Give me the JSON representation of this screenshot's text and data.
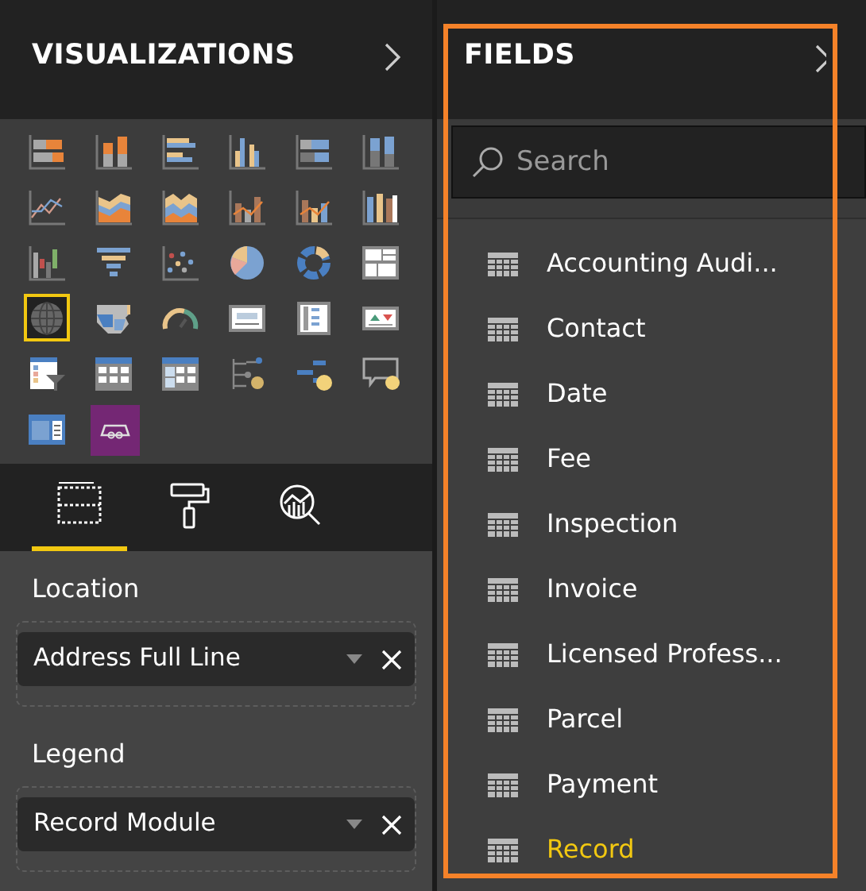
{
  "visualizations": {
    "title": "VISUALIZATIONS",
    "visuals": [
      {
        "selected": false
      },
      {
        "selected": false
      },
      {
        "selected": false
      },
      {
        "selected": false
      },
      {
        "selected": false
      },
      {
        "selected": false
      },
      {
        "selected": false
      },
      {
        "selected": false
      },
      {
        "selected": false
      },
      {
        "selected": false
      },
      {
        "selected": false
      },
      {
        "selected": false
      },
      {
        "selected": false
      },
      {
        "selected": false
      },
      {
        "selected": false
      },
      {
        "selected": false
      },
      {
        "selected": false
      },
      {
        "selected": false
      },
      {
        "selected": true
      },
      {
        "selected": false
      },
      {
        "selected": false
      },
      {
        "selected": false
      },
      {
        "selected": false
      },
      {
        "selected": false
      },
      {
        "selected": false
      },
      {
        "selected": false
      },
      {
        "selected": false
      },
      {
        "selected": false
      },
      {
        "selected": false
      },
      {
        "selected": false
      },
      {
        "selected": false
      },
      {
        "selected": false
      }
    ],
    "tabs": [
      {
        "selected": true
      },
      {
        "selected": false
      },
      {
        "selected": false
      }
    ],
    "wells": [
      {
        "label": "Location",
        "value": "Address Full Line"
      },
      {
        "label": "Legend",
        "value": "Record Module"
      }
    ]
  },
  "fields": {
    "title": "FIELDS",
    "search": {
      "placeholder": "Search"
    },
    "tables": [
      {
        "name": "Accounting Audi...",
        "selected": false
      },
      {
        "name": "Contact",
        "selected": false
      },
      {
        "name": "Date",
        "selected": false
      },
      {
        "name": "Fee",
        "selected": false
      },
      {
        "name": "Inspection",
        "selected": false
      },
      {
        "name": "Invoice",
        "selected": false
      },
      {
        "name": "Licensed Profess...",
        "selected": false
      },
      {
        "name": "Parcel",
        "selected": false
      },
      {
        "name": "Payment",
        "selected": false
      },
      {
        "name": "Record",
        "selected": true
      }
    ]
  }
}
